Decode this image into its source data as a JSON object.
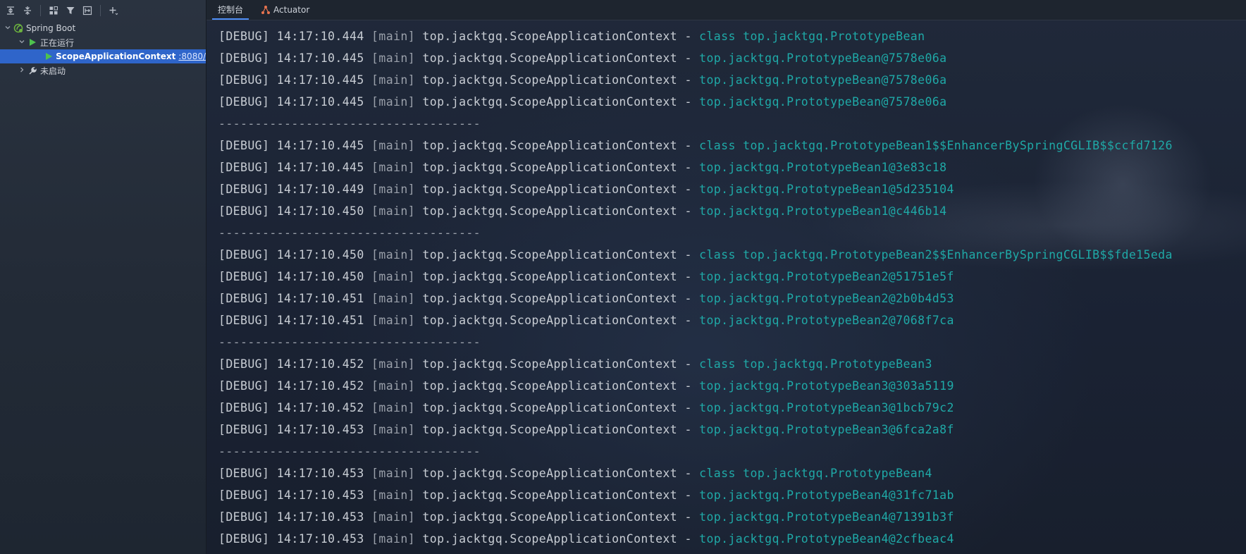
{
  "toolbar": {
    "icons": [
      "expand-all-icon",
      "collapse-all-icon",
      "group-icon",
      "filter-icon",
      "new-config-icon",
      "add-service-icon"
    ]
  },
  "tree": {
    "root_label": "Spring Boot",
    "running_label": "正在运行",
    "app_label": "ScopeApplicationContext",
    "app_port": ":8080/",
    "not_started_label": "未启动"
  },
  "tabs": [
    {
      "label": "控制台",
      "active": true
    },
    {
      "label": "Actuator",
      "active": false
    }
  ],
  "colors": {
    "accent": "#2f65ca",
    "message": "#1fa9a7",
    "run_green": "#4ec24e"
  },
  "console": {
    "lines": [
      {
        "type": "log",
        "level": "[DEBUG]",
        "time": "14:17:10.444",
        "thread": "[main]",
        "logger": "top.jacktgq.ScopeApplicationContext",
        "sep": "-",
        "msg": "class top.jacktgq.PrototypeBean"
      },
      {
        "type": "log",
        "level": "[DEBUG]",
        "time": "14:17:10.445",
        "thread": "[main]",
        "logger": "top.jacktgq.ScopeApplicationContext",
        "sep": "-",
        "msg": "top.jacktgq.PrototypeBean@7578e06a"
      },
      {
        "type": "log",
        "level": "[DEBUG]",
        "time": "14:17:10.445",
        "thread": "[main]",
        "logger": "top.jacktgq.ScopeApplicationContext",
        "sep": "-",
        "msg": "top.jacktgq.PrototypeBean@7578e06a"
      },
      {
        "type": "log",
        "level": "[DEBUG]",
        "time": "14:17:10.445",
        "thread": "[main]",
        "logger": "top.jacktgq.ScopeApplicationContext",
        "sep": "-",
        "msg": "top.jacktgq.PrototypeBean@7578e06a"
      },
      {
        "type": "sep",
        "text": "------------------------------------"
      },
      {
        "type": "log",
        "level": "[DEBUG]",
        "time": "14:17:10.445",
        "thread": "[main]",
        "logger": "top.jacktgq.ScopeApplicationContext",
        "sep": "-",
        "msg": "class top.jacktgq.PrototypeBean1$$EnhancerBySpringCGLIB$$ccfd7126"
      },
      {
        "type": "log",
        "level": "[DEBUG]",
        "time": "14:17:10.445",
        "thread": "[main]",
        "logger": "top.jacktgq.ScopeApplicationContext",
        "sep": "-",
        "msg": "top.jacktgq.PrototypeBean1@3e83c18"
      },
      {
        "type": "log",
        "level": "[DEBUG]",
        "time": "14:17:10.449",
        "thread": "[main]",
        "logger": "top.jacktgq.ScopeApplicationContext",
        "sep": "-",
        "msg": "top.jacktgq.PrototypeBean1@5d235104"
      },
      {
        "type": "log",
        "level": "[DEBUG]",
        "time": "14:17:10.450",
        "thread": "[main]",
        "logger": "top.jacktgq.ScopeApplicationContext",
        "sep": "-",
        "msg": "top.jacktgq.PrototypeBean1@c446b14"
      },
      {
        "type": "sep",
        "text": "------------------------------------"
      },
      {
        "type": "log",
        "level": "[DEBUG]",
        "time": "14:17:10.450",
        "thread": "[main]",
        "logger": "top.jacktgq.ScopeApplicationContext",
        "sep": "-",
        "msg": "class top.jacktgq.PrototypeBean2$$EnhancerBySpringCGLIB$$fde15eda"
      },
      {
        "type": "log",
        "level": "[DEBUG]",
        "time": "14:17:10.450",
        "thread": "[main]",
        "logger": "top.jacktgq.ScopeApplicationContext",
        "sep": "-",
        "msg": "top.jacktgq.PrototypeBean2@51751e5f"
      },
      {
        "type": "log",
        "level": "[DEBUG]",
        "time": "14:17:10.451",
        "thread": "[main]",
        "logger": "top.jacktgq.ScopeApplicationContext",
        "sep": "-",
        "msg": "top.jacktgq.PrototypeBean2@2b0b4d53"
      },
      {
        "type": "log",
        "level": "[DEBUG]",
        "time": "14:17:10.451",
        "thread": "[main]",
        "logger": "top.jacktgq.ScopeApplicationContext",
        "sep": "-",
        "msg": "top.jacktgq.PrototypeBean2@7068f7ca"
      },
      {
        "type": "sep",
        "text": "------------------------------------"
      },
      {
        "type": "log",
        "level": "[DEBUG]",
        "time": "14:17:10.452",
        "thread": "[main]",
        "logger": "top.jacktgq.ScopeApplicationContext",
        "sep": "-",
        "msg": "class top.jacktgq.PrototypeBean3"
      },
      {
        "type": "log",
        "level": "[DEBUG]",
        "time": "14:17:10.452",
        "thread": "[main]",
        "logger": "top.jacktgq.ScopeApplicationContext",
        "sep": "-",
        "msg": "top.jacktgq.PrototypeBean3@303a5119"
      },
      {
        "type": "log",
        "level": "[DEBUG]",
        "time": "14:17:10.452",
        "thread": "[main]",
        "logger": "top.jacktgq.ScopeApplicationContext",
        "sep": "-",
        "msg": "top.jacktgq.PrototypeBean3@1bcb79c2"
      },
      {
        "type": "log",
        "level": "[DEBUG]",
        "time": "14:17:10.453",
        "thread": "[main]",
        "logger": "top.jacktgq.ScopeApplicationContext",
        "sep": "-",
        "msg": "top.jacktgq.PrototypeBean3@6fca2a8f"
      },
      {
        "type": "sep",
        "text": "------------------------------------"
      },
      {
        "type": "log",
        "level": "[DEBUG]",
        "time": "14:17:10.453",
        "thread": "[main]",
        "logger": "top.jacktgq.ScopeApplicationContext",
        "sep": "-",
        "msg": "class top.jacktgq.PrototypeBean4"
      },
      {
        "type": "log",
        "level": "[DEBUG]",
        "time": "14:17:10.453",
        "thread": "[main]",
        "logger": "top.jacktgq.ScopeApplicationContext",
        "sep": "-",
        "msg": "top.jacktgq.PrototypeBean4@31fc71ab"
      },
      {
        "type": "log",
        "level": "[DEBUG]",
        "time": "14:17:10.453",
        "thread": "[main]",
        "logger": "top.jacktgq.ScopeApplicationContext",
        "sep": "-",
        "msg": "top.jacktgq.PrototypeBean4@71391b3f"
      },
      {
        "type": "log",
        "level": "[DEBUG]",
        "time": "14:17:10.453",
        "thread": "[main]",
        "logger": "top.jacktgq.ScopeApplicationContext",
        "sep": "-",
        "msg": "top.jacktgq.PrototypeBean4@2cfbeac4"
      }
    ]
  }
}
